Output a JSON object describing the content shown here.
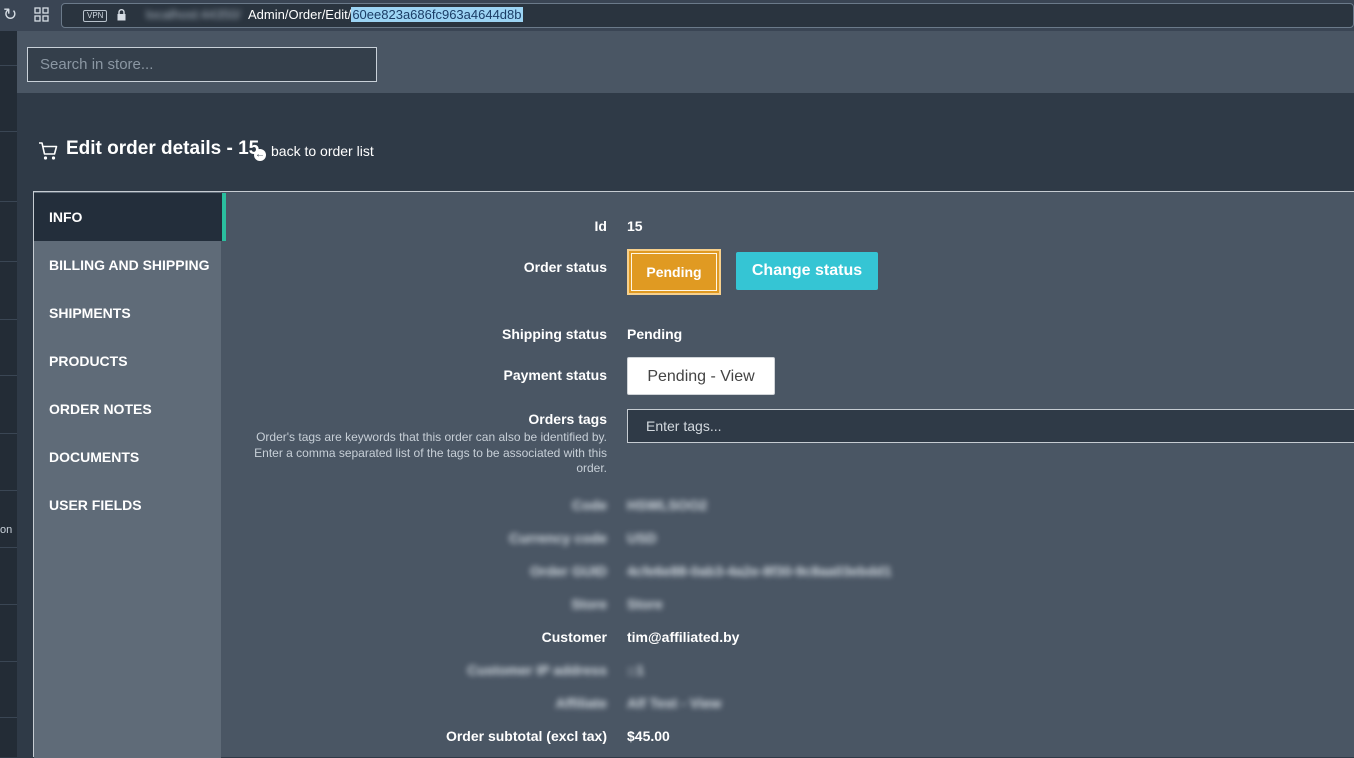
{
  "browser": {
    "vpn_label": "VPN",
    "host": "localhost:44350/",
    "path": "Admin/Order/Edit/",
    "selected_id": "60ee823a686fc963a4644d8b"
  },
  "left_strip": {
    "partial_text": "on"
  },
  "search": {
    "placeholder": "Search in store..."
  },
  "page": {
    "title": "Edit order details - 15",
    "back_link": "back to order list"
  },
  "tabs": [
    {
      "label": "INFO",
      "active": true
    },
    {
      "label": "BILLING AND SHIPPING"
    },
    {
      "label": "SHIPMENTS"
    },
    {
      "label": "PRODUCTS"
    },
    {
      "label": "ORDER NOTES"
    },
    {
      "label": "DOCUMENTS"
    },
    {
      "label": "USER FIELDS"
    }
  ],
  "info": {
    "id_label": "Id",
    "id_value": "15",
    "order_status_label": "Order status",
    "order_status_value": "Pending",
    "change_status_button": "Change status",
    "shipping_status_label": "Shipping status",
    "shipping_status_value": "Pending",
    "payment_status_label": "Payment status",
    "payment_status_button": "Pending - View",
    "orders_tags_label": "Orders tags",
    "orders_tags_help": "Order's tags are keywords that this order can also be identified by. Enter a comma separated list of the tags to be associated with this order.",
    "orders_tags_placeholder": "Enter tags...",
    "code_label": "Code",
    "code_value": "HSWLSOO2",
    "currency_label": "Currency code",
    "currency_value": "USD",
    "guid_label": "Order GUID",
    "guid_value": "4cfe6e88-0ab3-4a2e-8f30-9c8aa03ebdd1",
    "store_label": "Store",
    "store_value": "Store",
    "customer_label": "Customer",
    "customer_value": "tim@affiliated.by",
    "ip_label": "Customer IP address",
    "ip_value": "::1",
    "affiliate_label": "Affiliate",
    "affiliate_value": "Alf Test - View",
    "subtotal_label": "Order subtotal (excl tax)",
    "subtotal_value": "$45.00"
  },
  "colors": {
    "active_tab_accent": "#2abf9e",
    "pending_button": "#e09a22",
    "change_status_button": "#35c5d4"
  }
}
